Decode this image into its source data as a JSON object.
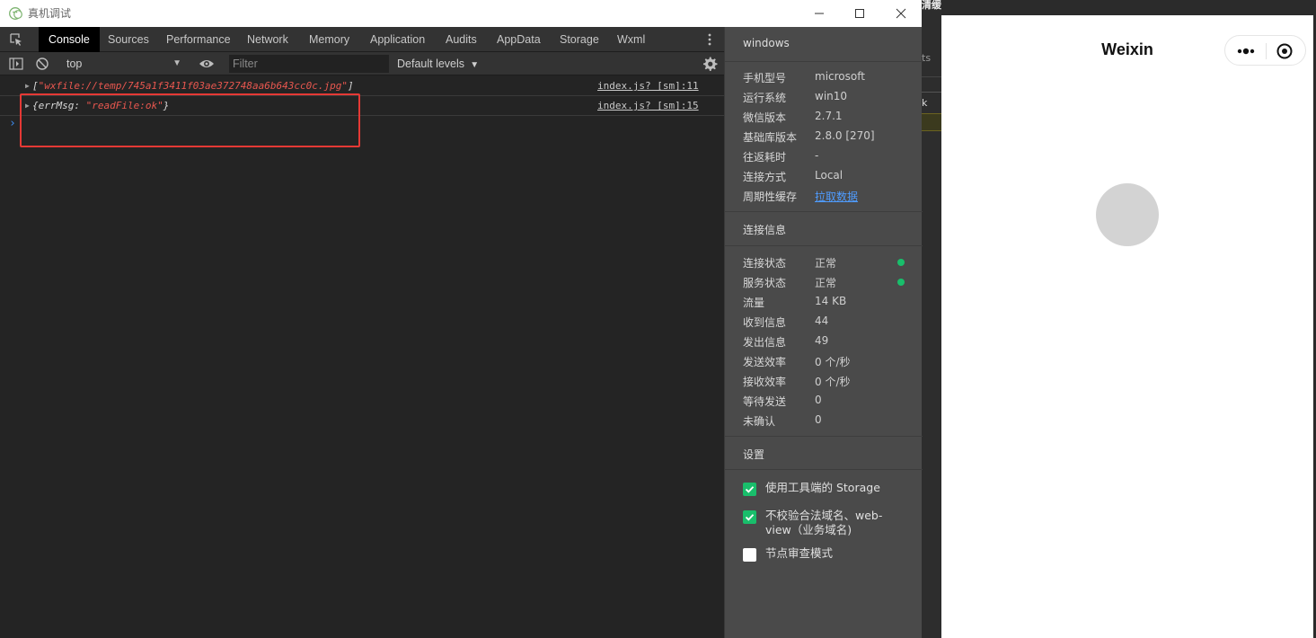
{
  "background_app": {
    "top_text": "清缓存",
    "partial_label": "ts",
    "partial_label_2": "k"
  },
  "window": {
    "title": "真机调试",
    "minimize_label": "—",
    "maximize_label": "☐",
    "close_label": "✕"
  },
  "devtools": {
    "tabs": [
      "Console",
      "Sources",
      "Performance",
      "Network",
      "Memory",
      "Application",
      "Audits",
      "AppData",
      "Storage",
      "Wxml"
    ],
    "active_tab": "Console",
    "context": "top",
    "filter_placeholder": "Filter",
    "levels": "Default levels"
  },
  "console": {
    "logs": [
      {
        "prefix": "[",
        "string": "\"wxfile://temp/745a1f3411f03ae372748aa6b643cc0c.jpg\"",
        "suffix": "]",
        "source": "index.js? [sm]:11"
      },
      {
        "prefix": "{errMsg: ",
        "string": "\"readFile:ok\"",
        "suffix": "}",
        "source": "index.js? [sm]:15"
      }
    ],
    "prompt": "›"
  },
  "panel": {
    "device_title": "windows",
    "device_info": [
      {
        "k": "手机型号",
        "v": "microsoft"
      },
      {
        "k": "运行系统",
        "v": "win10"
      },
      {
        "k": "微信版本",
        "v": "2.7.1"
      },
      {
        "k": "基础库版本",
        "v": "2.8.0 [270]"
      },
      {
        "k": "往返耗时",
        "v": "-"
      },
      {
        "k": "连接方式",
        "v": "Local"
      },
      {
        "k": "周期性缓存",
        "v": "拉取数据"
      }
    ],
    "connection_title": "连接信息",
    "connection_info": [
      {
        "k": "连接状态",
        "v": "正常"
      },
      {
        "k": "服务状态",
        "v": "正常"
      },
      {
        "k": "流量",
        "v": "14 KB"
      },
      {
        "k": "收到信息",
        "v": "44"
      },
      {
        "k": "发出信息",
        "v": "49"
      },
      {
        "k": "发送效率",
        "v": "0 个/秒"
      },
      {
        "k": "接收效率",
        "v": "0 个/秒"
      },
      {
        "k": "等待发送",
        "v": "0"
      },
      {
        "k": "未确认",
        "v": "0"
      }
    ],
    "status_color": "#19be6b",
    "settings_title": "设置",
    "settings": [
      {
        "label": "使用工具端的 Storage",
        "checked": true
      },
      {
        "label_line1": "不校验合法域名、web-",
        "label_line2": "view（业务域名)",
        "checked": true
      },
      {
        "label": "节点审查模式",
        "checked": false
      }
    ]
  },
  "phone": {
    "nav_title": "Weixin"
  },
  "colors": {
    "accent_link": "#4f9cff",
    "highlight_border": "#e53935",
    "error_string": "#e8574f"
  }
}
